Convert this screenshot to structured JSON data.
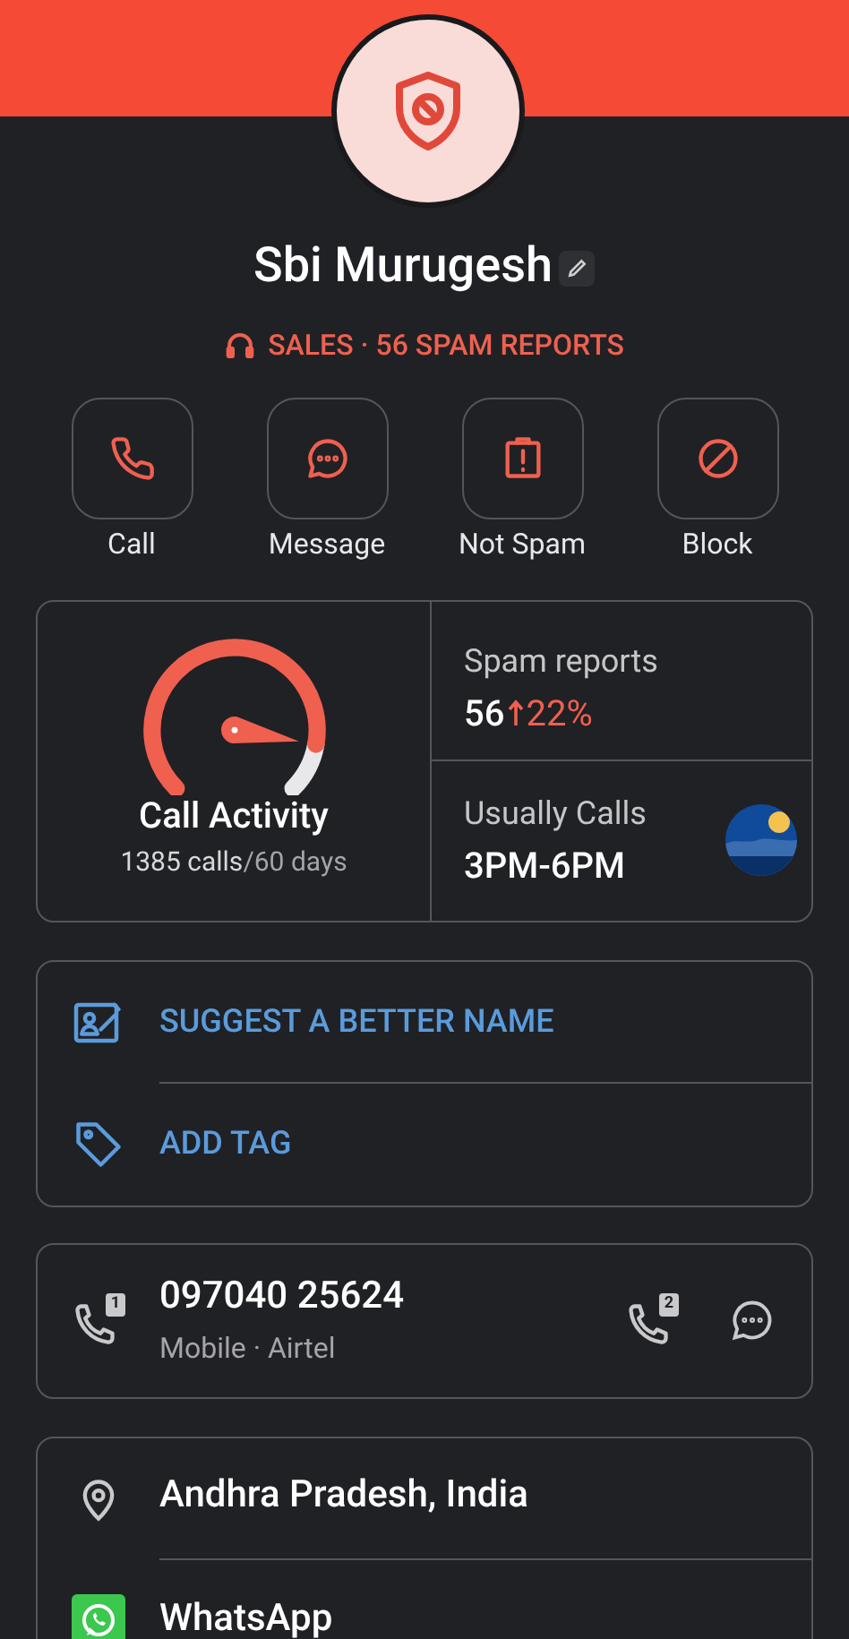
{
  "profile": {
    "name": "Sbi Murugesh",
    "subtitle": "SALES · 56 SPAM REPORTS"
  },
  "actions": [
    {
      "kind": "call",
      "label": "Call"
    },
    {
      "kind": "message",
      "label": "Message"
    },
    {
      "kind": "notspam",
      "label": "Not Spam"
    },
    {
      "kind": "block",
      "label": "Block"
    }
  ],
  "stats": {
    "activity": {
      "title": "Call Activity",
      "calls": "1385 calls",
      "period": "/60 days"
    },
    "spam": {
      "label": "Spam reports",
      "count": "56",
      "change": "22%"
    },
    "usual": {
      "label": "Usually Calls",
      "time": "3PM-6PM"
    }
  },
  "links": [
    {
      "kind": "name",
      "label": "SUGGEST A BETTER NAME"
    },
    {
      "kind": "tag",
      "label": "ADD TAG"
    }
  ],
  "phone": {
    "number": "097040 25624",
    "detail": "Mobile · Airtel",
    "sim_1": "1",
    "sim_2": "2"
  },
  "info": [
    {
      "kind": "location",
      "label": "Andhra Pradesh, India"
    },
    {
      "kind": "whatsapp",
      "label": "WhatsApp"
    }
  ]
}
